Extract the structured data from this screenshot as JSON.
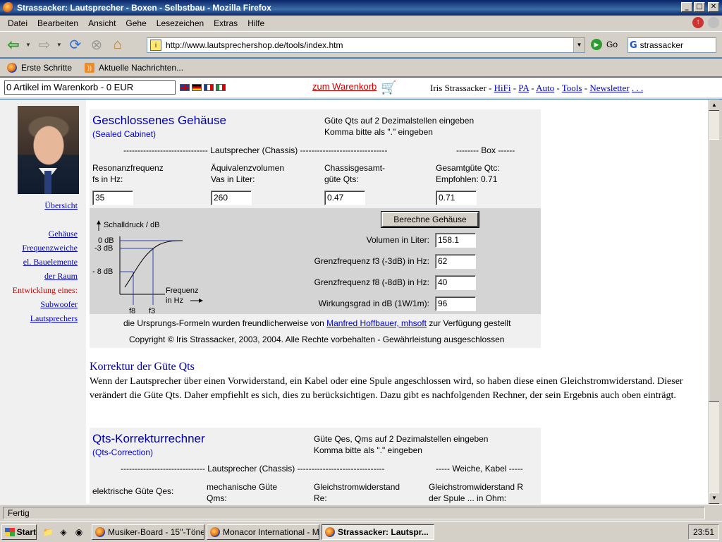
{
  "window": {
    "title": "Strassacker: Lautsprecher - Boxen - Selbstbau - Mozilla Firefox"
  },
  "menu": [
    "Datei",
    "Bearbeiten",
    "Ansicht",
    "Gehe",
    "Lesezeichen",
    "Extras",
    "Hilfe"
  ],
  "nav": {
    "url": "http://www.lautsprechershop.de/tools/index.htm",
    "go_label": "Go",
    "search_value": "strassacker"
  },
  "bookmarks": [
    "Erste Schritte",
    "Aktuelle Nachrichten..."
  ],
  "topframe": {
    "cart_value": "0 Artikel im Warenkorb - 0 EUR",
    "cart_link": "zum Warenkorb",
    "owner": "Iris Strassacker - ",
    "links": [
      "HiFi",
      "PA",
      "Auto",
      "Tools",
      "Newsletter",
      ". . ."
    ],
    "dash": " - "
  },
  "sidebar": {
    "overview": "Übersicht",
    "links": [
      "Gehäuse",
      "Frequenzweiche",
      "el. Bauelemente",
      "der Raum"
    ],
    "red_text": "Entwicklung eines:",
    "links2": [
      "Subwoofer",
      "Lautsprechers"
    ]
  },
  "calc1": {
    "title": "Geschlossenes Gehäuse",
    "subtitle": "(Sealed Cabinet)",
    "note1": "Güte Qts auf 2 Dezimalstellen eingeben",
    "note2": "Komma bitte als \".\" eingeben",
    "sep_chassis": "------------------------------ Lautsprecher (Chassis) -------------------------------",
    "sep_box": "-------- Box ------",
    "fields": [
      {
        "l1": "Resonanzfrequenz",
        "l2": "fs in Hz:",
        "value": "35"
      },
      {
        "l1": "Äquivalenzvolumen",
        "l2": "Vas in Liter:",
        "value": "260"
      },
      {
        "l1": "Chassisgesamt-",
        "l2": "güte Qts:",
        "value": "0.47"
      },
      {
        "l1": "Gesamtgüte Qtc:",
        "l2": "Empfohlen: 0.71",
        "value": "0.71"
      }
    ],
    "button": "Berechne Gehäuse",
    "results": [
      {
        "label": "Volumen in Liter:",
        "value": "158.1"
      },
      {
        "label": "Grenzfrequenz f3 (-3dB) in Hz:",
        "value": "62"
      },
      {
        "label": "Grenzfrequenz f8 (-8dB) in Hz:",
        "value": "40"
      },
      {
        "label": "Wirkungsgrad in dB (1W/1m):",
        "value": "96"
      }
    ],
    "diagram": {
      "ylabel": "Schalldruck / dB",
      "db0": "0 dB",
      "db3": "-3 dB",
      "db8": "- 8 dB",
      "f8": "f8",
      "f3": "f3",
      "xlabel1": "Frequenz",
      "xlabel2": "in Hz"
    },
    "credit_pre": "die Ursprungs-Formeln wurden freundlicherweise von ",
    "credit_link": "Manfred Hoffbauer, mhsoft",
    "credit_post": " zur Verfügung gestellt",
    "copyright": "Copyright © Iris Strassacker, 2003, 2004. Alle Rechte vorbehalten - Gewährleistung ausgeschlossen"
  },
  "korrektur": {
    "title": "Korrektur der Güte Qts",
    "text": "Wenn der Lautsprecher über einen Vorwiderstand, ein Kabel oder eine Spule angeschlossen wird, so haben diese einen Gleichstromwiderstand. Dieser verändert die Güte Qts. Daher empfiehlt es sich, dies zu berücksichtigen. Dazu gibt es nachfolgenden Rechner, der sein Ergebnis auch oben einträgt."
  },
  "calc2": {
    "title": "Qts-Korrekturrechner",
    "subtitle": "(Qts-Correction)",
    "note1": "Güte Qes, Qms auf 2 Dezimalstellen eingeben",
    "note2": "Komma bitte als \".\" eingeben",
    "sep_chassis": "------------------------------ Lautsprecher (Chassis) -------------------------------",
    "sep_box": "----- Weiche, Kabel -----",
    "fields": [
      {
        "l1": "elektrische Güte Qes:",
        "l2": ""
      },
      {
        "l1": "mechanische Güte",
        "l2": "Qms:"
      },
      {
        "l1": "Gleichstromwiderstand",
        "l2": "Re:"
      },
      {
        "l1": "Gleichstromwiderstand R",
        "l2": "der Spule ... in Ohm:"
      }
    ]
  },
  "status": "Fertig",
  "taskbar": {
    "start": "Start",
    "tasks": [
      "Musiker-Board - 15''-Töne...",
      "Monacor International - M...",
      "Strassacker: Lautspr..."
    ],
    "clock": "23:51"
  },
  "colors": {
    "link": "#0000cc",
    "title_blue": "#0000aa",
    "cart_red": "#cc0000",
    "panel": "#f0f0f0",
    "panel_dark": "#d4d4d4"
  }
}
